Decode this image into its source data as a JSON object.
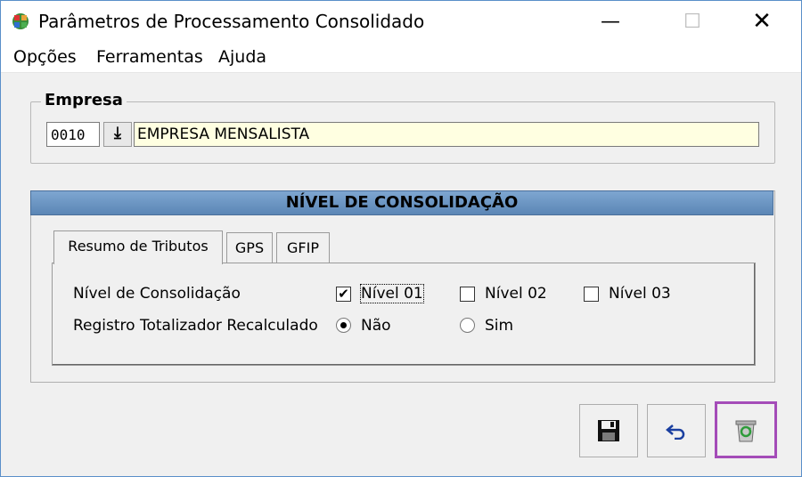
{
  "window": {
    "title": "Parâmetros de Processamento Consolidado",
    "minimize_glyph": "—",
    "maximize_glyph": "☐",
    "close_glyph": "✕"
  },
  "menu": [
    "Opções",
    "Ferramentas",
    "Ajuda"
  ],
  "empresa": {
    "label": "Empresa",
    "code": "0010",
    "lookup_glyph": "⤓",
    "name": "EMPRESA MENSALISTA"
  },
  "panel": {
    "title": "NÍVEL DE CONSOLIDAÇÃO",
    "tabs": [
      "Resumo de Tributos",
      "GPS",
      "GFIP"
    ],
    "active_tab": 0,
    "rows": [
      {
        "label": "Nível de Consolidação",
        "options": [
          {
            "label": "Nível 01",
            "checked": true
          },
          {
            "label": "Nível 02",
            "checked": false
          },
          {
            "label": "Nível 03",
            "checked": false
          }
        ]
      },
      {
        "label": "Registro Totalizador Recalculado",
        "options": [
          {
            "label": "Não",
            "selected": true
          },
          {
            "label": "Sim",
            "selected": false
          }
        ]
      }
    ]
  },
  "icons": {
    "app": "grid-app-icon",
    "save": "floppy-disk-icon",
    "undo": "undo-arrow-icon",
    "recycle": "recycle-bin-icon"
  },
  "colors": {
    "header_blue": "#5b86b5",
    "name_field": "#ffffe1",
    "highlight": "#a44cb8"
  }
}
